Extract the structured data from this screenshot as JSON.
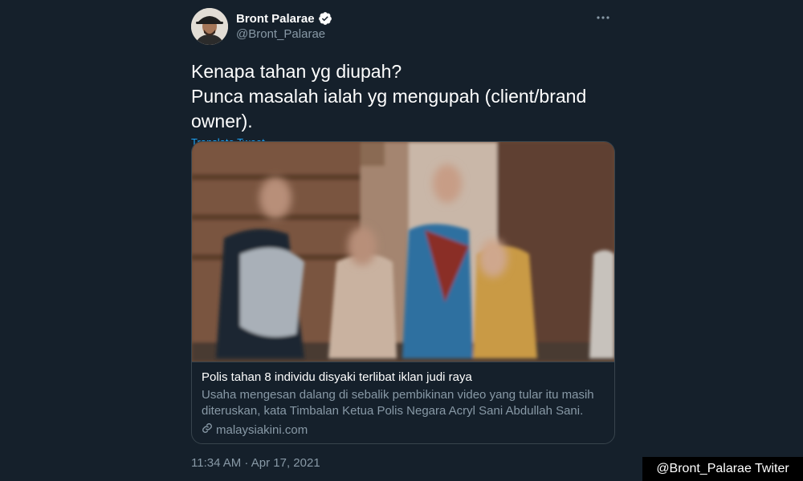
{
  "author": {
    "display_name": "Bront Palarae",
    "handle": "@Bront_Palarae",
    "verified": true,
    "avatar_icon": "avatar-photo"
  },
  "tweet": {
    "text": "Kenapa tahan yg diupah?\nPunca masalah ialah yg mengupah (client/brand owner).",
    "translate_label": "Translate Tweet",
    "timestamp": "11:34 AM · Apr 17, 2021"
  },
  "card": {
    "title": "Polis tahan 8 individu disyaki terlibat iklan judi raya",
    "description": "Usaha mengesan dalang di sebalik pembikinan video yang tular itu masih diteruskan, kata Timbalan Ketua Polis Negara Acryl Sani Abdullah Sani.",
    "domain": "malaysiakini.com",
    "domain_icon": "link-icon"
  },
  "watermark": "@Bront_Palarae Twiter",
  "colors": {
    "background": "#15202b",
    "border": "#38444d",
    "secondary_text": "#8899a6",
    "accent": "#1da1f2"
  }
}
